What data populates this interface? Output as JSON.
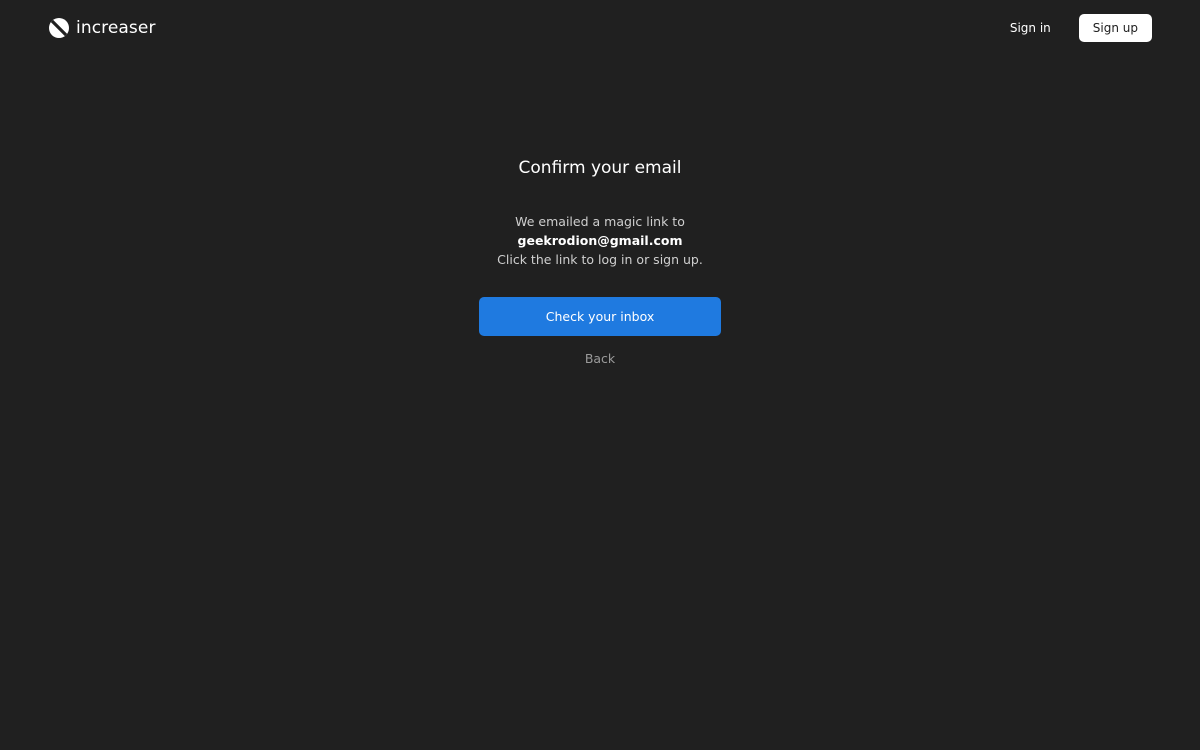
{
  "brand": {
    "name": "increaser",
    "logo_icon": "half-circle-logo-icon"
  },
  "nav": {
    "signin_label": "Sign in",
    "signup_label": "Sign up"
  },
  "confirm": {
    "title": "Confirm your email",
    "line1": "We emailed a magic link to",
    "email": "geekrodion@gmail.com",
    "line3": "Click the link to log in or sign up.",
    "primary_label": "Check your inbox",
    "back_label": "Back"
  },
  "colors": {
    "background": "#202020",
    "accent": "#1f7ae0",
    "muted_text": "#9a9a9a"
  }
}
